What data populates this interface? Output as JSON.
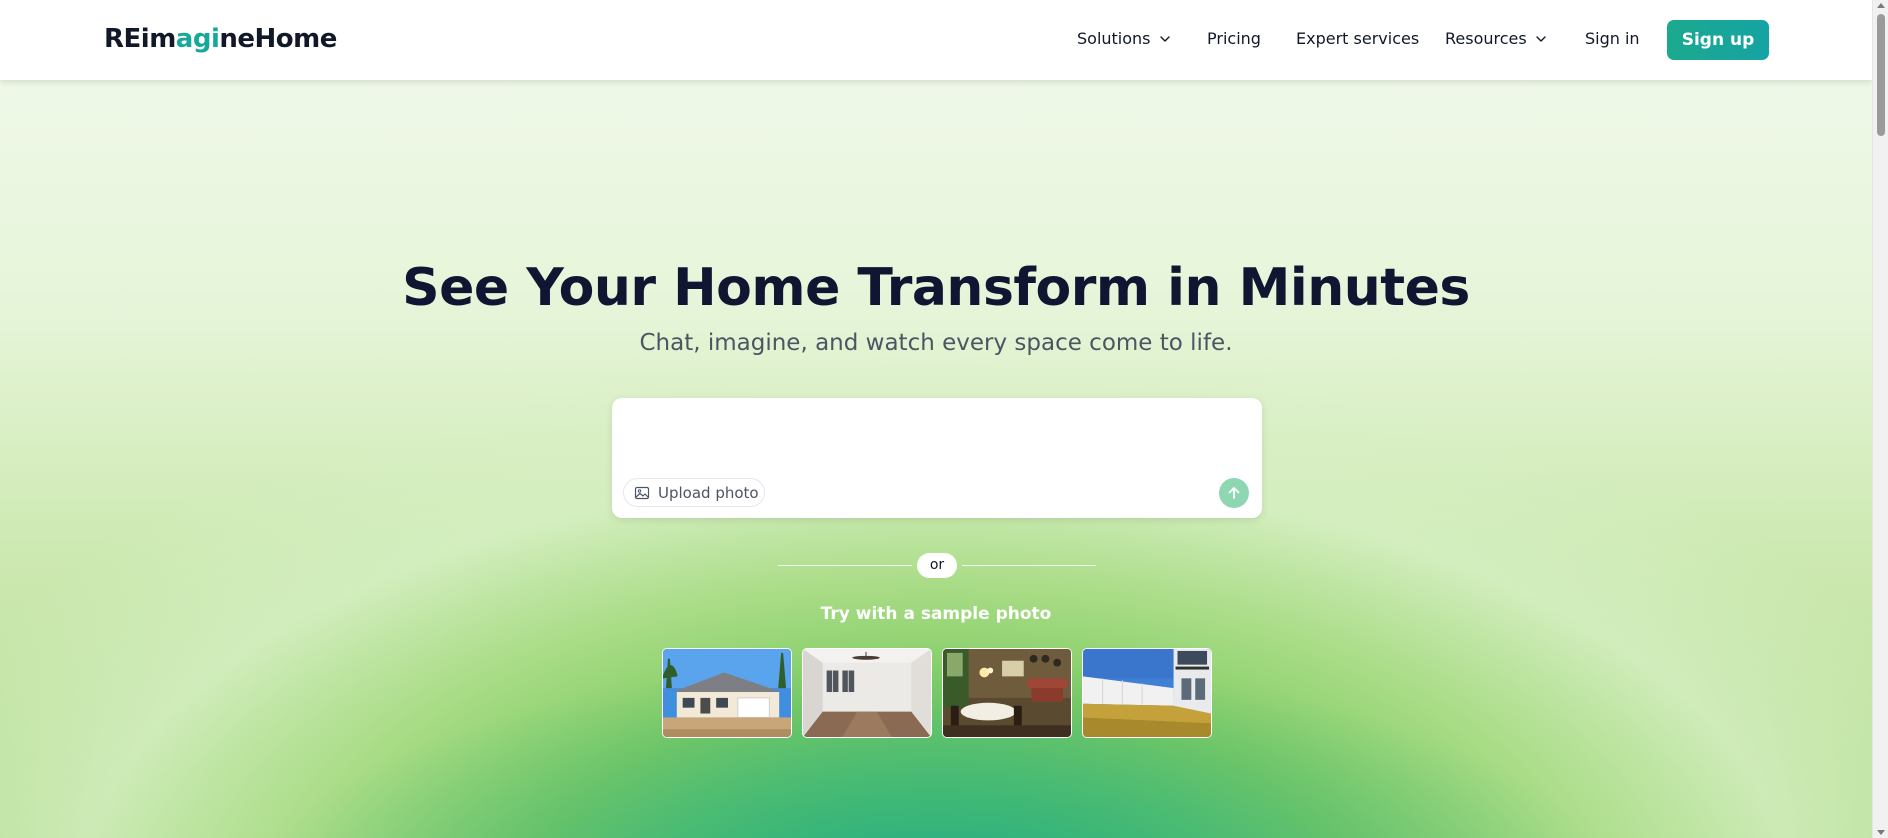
{
  "header": {
    "logo": {
      "part1": "REim",
      "part2": "agi",
      "part3": "neHome"
    },
    "nav": [
      {
        "label": "Solutions",
        "has_dropdown": true
      },
      {
        "label": "Pricing",
        "has_dropdown": false
      },
      {
        "label": "Expert services",
        "has_dropdown": false
      },
      {
        "label": "Resources",
        "has_dropdown": true
      },
      {
        "label": "Sign in",
        "has_dropdown": false
      }
    ],
    "signup_label": "Sign up"
  },
  "hero": {
    "title": "See Your Home Transform in Minutes",
    "subtitle": "Chat, imagine, and watch every space come to life."
  },
  "prompt": {
    "value": "",
    "upload_label": "Upload photo"
  },
  "divider": {
    "or_label": "or"
  },
  "samples": {
    "label": "Try with a sample photo",
    "photos": [
      {
        "name": "house exterior"
      },
      {
        "name": "empty room"
      },
      {
        "name": "dining room"
      },
      {
        "name": "backyard"
      }
    ]
  },
  "colors": {
    "brand": "#16a89a",
    "signup_gradient_start": "#1ba98e",
    "signup_gradient_end": "#16a3a4",
    "title": "#101631",
    "send_button": "#8fd6b3"
  }
}
